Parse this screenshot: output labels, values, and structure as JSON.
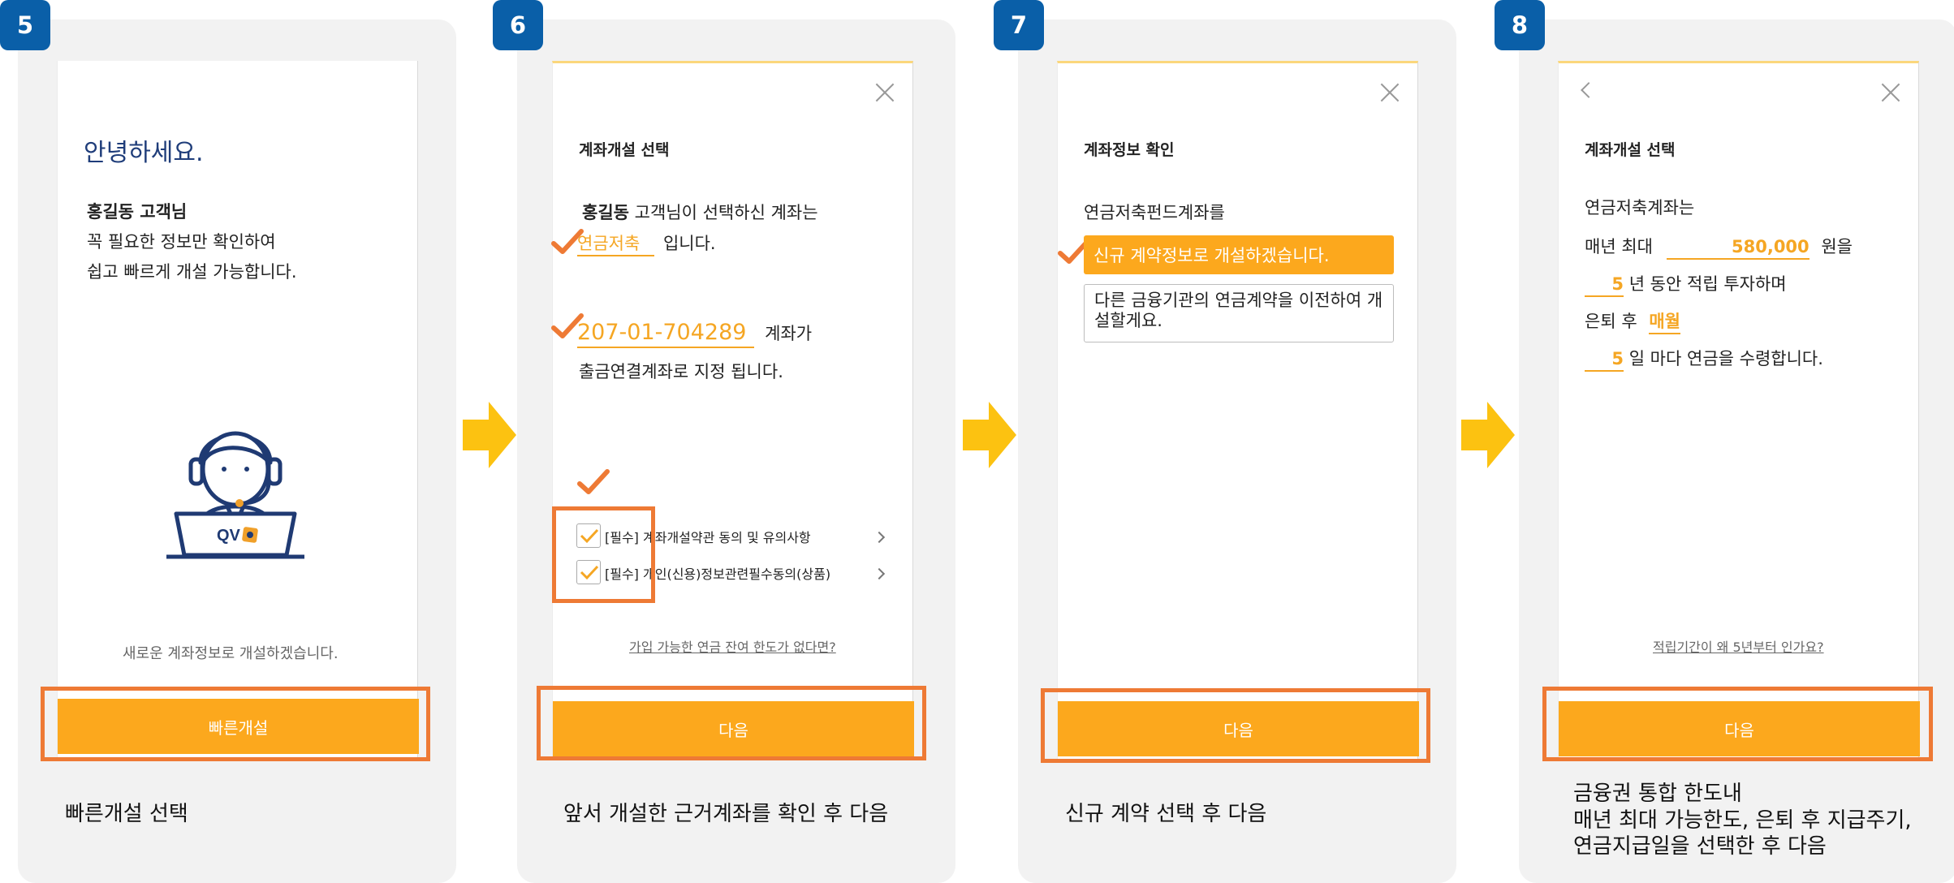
{
  "colors": {
    "badge": "#0a5fa8",
    "accent": "#fca81d",
    "highlight": "#ee7a35",
    "arrow": "#fcc211"
  },
  "step5": {
    "badge": "5",
    "greeting": "안녕하세요.",
    "customer": "홍길동 고객님",
    "line1": "꼭 필요한 정보만 확인하여",
    "line2": "쉽고 빠르게 개설 가능합니다.",
    "logo_text": "QV",
    "new_account_text": "새로운 계좌정보로 개설하겠습니다.",
    "button": "빠른개설",
    "caption": "빠른개설 선택"
  },
  "step6": {
    "badge": "6",
    "heading": "계좌개설 선택",
    "name": "홍길동",
    "line1_rest": "고객님이 선택하신 계좌는",
    "account_type": "연금저축",
    "line2_rest": "입니다.",
    "account_number": "207-01-704289",
    "account_suffix": "계좌가",
    "line3": "출금연결계좌로 지정 됩니다.",
    "agree1": "[필수] 계좌개설약관 동의 및 유의사항",
    "agree2": "[필수] 개인(신용)정보관련필수동의(상품)",
    "link": "가입 가능한 연금 잔여 한도가 없다면?",
    "button": "다음",
    "caption": "앞서 개설한 근거계좌를 확인 후 다음"
  },
  "step7": {
    "badge": "7",
    "heading": "계좌정보 확인",
    "line1": "연금저축펀드계좌를",
    "option_new": "신규 계약정보로 개설하겠습니다.",
    "option_transfer": "다른 금융기관의 연금계약을 이전하여 개설할게요.",
    "button": "다음",
    "caption": "신규 계약 선택 후 다음"
  },
  "step8": {
    "badge": "8",
    "heading": "계좌개설 선택",
    "line1": "연금저축계좌는",
    "max_prefix": "매년 최대",
    "max_amount": "580,000",
    "max_suffix": "원을",
    "years": "5",
    "years_suffix": "년 동안 적립 투자하며",
    "retire_prefix": "은퇴 후",
    "cycle": "매월",
    "day": "5",
    "day_suffix": "일 마다  연금을 수령합니다.",
    "link": "적립기간이 왜 5년부터 인가요?",
    "button": "다음",
    "caption_lines": [
      "금융권 통합 한도내",
      "매년 최대 가능한도, 은퇴 후 지급주기,",
      "연금지급일을 선택한 후 다음"
    ]
  },
  "icons": [
    "close-icon",
    "back-icon",
    "check-icon",
    "chevron-right-icon",
    "arrow-right-icon",
    "counselor-icon"
  ]
}
